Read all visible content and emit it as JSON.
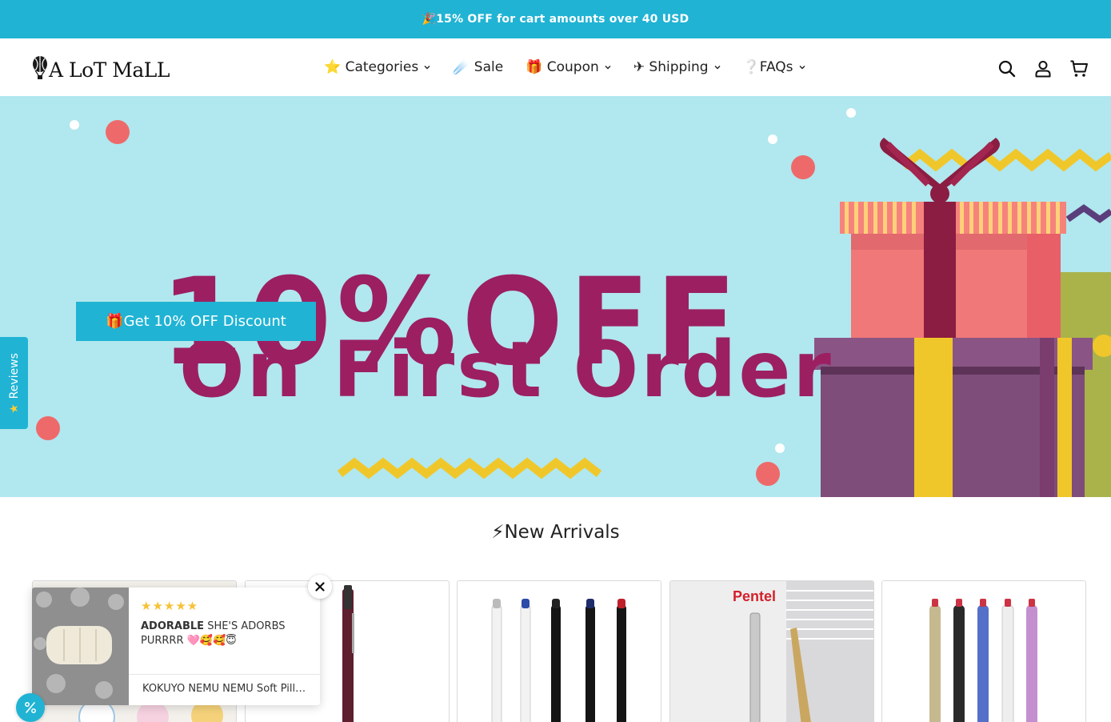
{
  "announcement": {
    "text": "🎉15% OFF for cart amounts over 40 USD"
  },
  "header": {
    "logo_text": "A LoT MaLL",
    "nav": [
      {
        "label": "⭐ Categories",
        "has_dropdown": true
      },
      {
        "label": "☄️ Sale",
        "has_dropdown": false
      },
      {
        "label": "🎁 Coupon",
        "has_dropdown": true
      },
      {
        "label": "✈ Shipping",
        "has_dropdown": true
      },
      {
        "label": "❔FAQs",
        "has_dropdown": true
      }
    ],
    "icons": [
      "search-icon",
      "account-icon",
      "cart-icon"
    ]
  },
  "banner": {
    "headline_line1": "10%OFF",
    "headline_line2": "On First Order",
    "cta_label": "🎁Get 10% OFF Discount",
    "colors": {
      "background": "#b1e7ee",
      "headline": "#9c1f62",
      "cta": "#20b3d4"
    }
  },
  "reviews_tab": {
    "label": "Reviews",
    "icon": "star-icon"
  },
  "new_arrivals": {
    "title": "⚡New Arrivals"
  },
  "review_popup": {
    "rating_stars": "★★★★★",
    "review_title": "ADORABLE",
    "review_body": " SHE'S ADORBS PURRRR 🩷🥰🥰😇",
    "product_name": "KOKUYO NEMU NEMU Soft Pillow Pen Case"
  },
  "colors": {
    "accent": "#20b3d4",
    "star": "#f6c237"
  }
}
